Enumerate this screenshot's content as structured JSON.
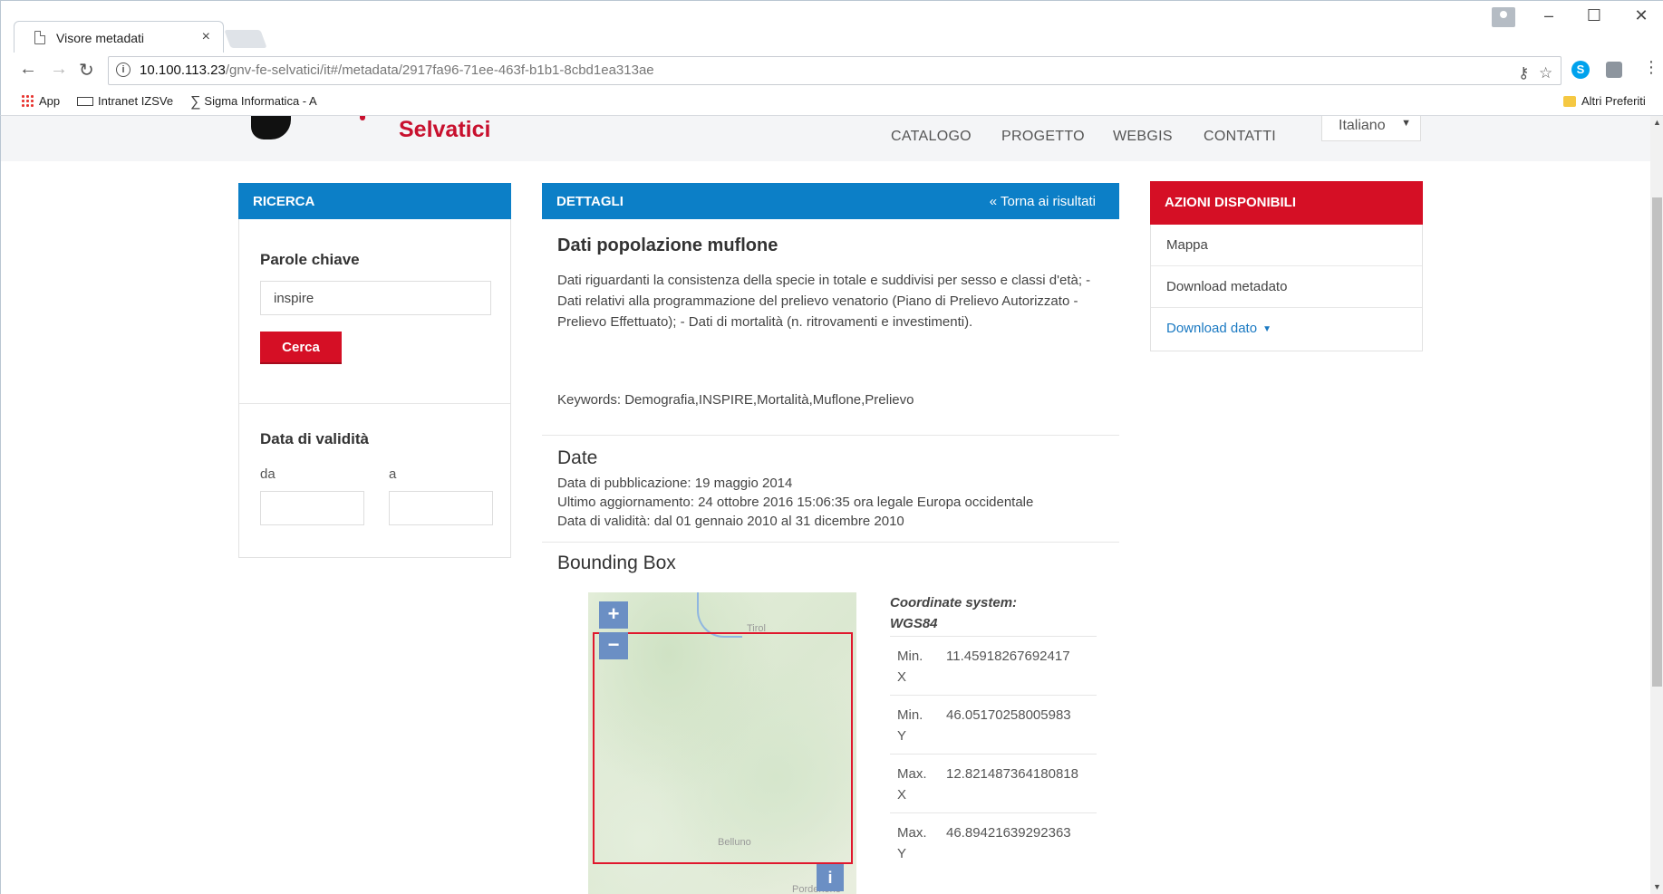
{
  "browser": {
    "tab_title": "Visore metadati",
    "tab_close": "×",
    "url_host": "10.100.113.23",
    "url_path": "/gnv-fe-selvatici/it#/metadata/2917fa96-71ee-463f-b1b1-8cbd1ea313ae",
    "bookmarks": [
      "App",
      "Intranet IZSVe",
      "Sigma Informatica - A"
    ],
    "other_bookmarks": "Altri Preferiti"
  },
  "site": {
    "logo_text": "Selvatici",
    "nav": [
      "CATALOGO",
      "PROGETTO",
      "WEBGIS",
      "CONTATTI"
    ],
    "language": "Italiano"
  },
  "search_panel": {
    "header": "RICERCA",
    "keywords_label": "Parole chiave",
    "keywords_value": "inspire",
    "search_button": "Cerca",
    "validity_label": "Data di validità",
    "from_label": "da",
    "to_label": "a",
    "from_value": "",
    "to_value": ""
  },
  "details": {
    "header": "DETTAGLI",
    "back_link": "« Torna ai risultati",
    "title": "Dati popolazione muflone",
    "description": "Dati riguardanti la consistenza della specie in totale e suddivisi per sesso e classi d'età; - Dati relativi alla programmazione del prelievo venatorio (Piano di Prelievo Autorizzato - Prelievo Effettuato); - Dati di mortalità (n. ritrovamenti e investimenti).",
    "keywords": "Keywords: Demografia,INSPIRE,Mortalità,Muflone,Prelievo",
    "date_section": "Date",
    "publication_date": "Data di pubblicazione: 19 maggio 2014",
    "last_update": "Ultimo aggiornamento: 24 ottobre 2016 15:06:35 ora legale Europa occidentale",
    "validity": "Data di validità: dal 01 gennaio 2010 al 31 dicembre 2010",
    "bbox_section": "Bounding Box",
    "coord_system": "Coordinate system: WGS84",
    "coords": [
      {
        "key": "Min. X",
        "value": "11.45918267692417"
      },
      {
        "key": "Min. Y",
        "value": "46.05170258005983"
      },
      {
        "key": "Max. X",
        "value": "12.821487364180818"
      },
      {
        "key": "Max. Y",
        "value": "46.89421639292363"
      }
    ],
    "map": {
      "zoom_in": "+",
      "zoom_out": "−",
      "info": "i",
      "labels": [
        "Tirol",
        "Belluno",
        "Pordenone"
      ]
    }
  },
  "actions": {
    "header": "AZIONI DISPONIBILI",
    "items": [
      "Mappa",
      "Download metadato",
      "Download dato"
    ]
  },
  "colors": {
    "blue_header": "#0c7fc7",
    "red_accent": "#d50f25",
    "link": "#1a79c2"
  }
}
